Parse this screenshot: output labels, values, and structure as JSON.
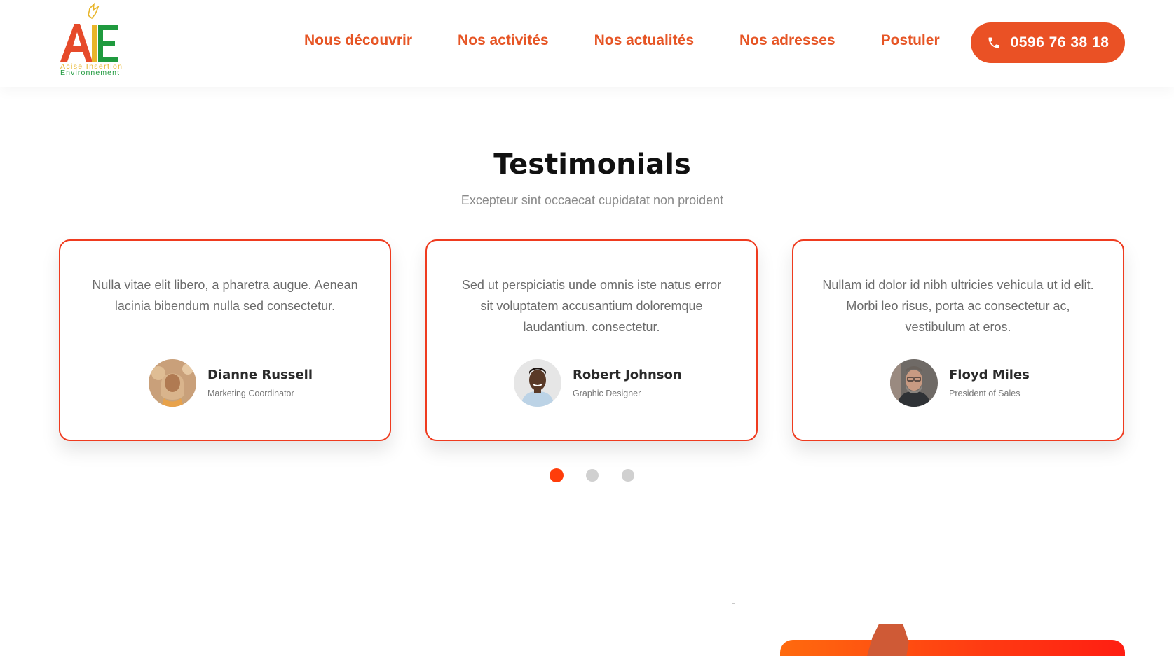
{
  "header": {
    "logo": {
      "text": "AIE",
      "line1": "Acise Insertion",
      "line2": "Environnement"
    },
    "nav": [
      {
        "label": "Nous découvrir"
      },
      {
        "label": "Nos activités"
      },
      {
        "label": "Nos actualités"
      },
      {
        "label": "Nos adresses"
      },
      {
        "label": "Postuler"
      }
    ],
    "phone": "0596 76 38 18"
  },
  "section": {
    "title": "Testimonials",
    "subtitle": "Excepteur sint occaecat cupidatat non proident"
  },
  "testimonials": [
    {
      "quote": "Nulla vitae elit libero, a pharetra augue. Aenean lacinia bibendum nulla sed consectetur.",
      "name": "Dianne Russell",
      "role": "Marketing Coordinator"
    },
    {
      "quote": "Sed ut perspiciatis unde omnis iste natus error sit voluptatem accusantium doloremque laudantium. consectetur.",
      "name": "Robert Johnson",
      "role": "Graphic Designer"
    },
    {
      "quote": "Nullam id dolor id nibh ultricies vehicula ut id elit. Morbi leo risus, porta ac consectetur ac, vestibulum at eros.",
      "name": "Floyd Miles",
      "role": "President of Sales"
    }
  ],
  "carousel": {
    "total_pages": 3,
    "active_page": 1
  },
  "colors": {
    "accent": "#ea5125",
    "card_border": "#ef3b1f",
    "logo_red": "#e64a2a",
    "logo_green": "#1f9a3e",
    "logo_yellow": "#e8b52a"
  }
}
